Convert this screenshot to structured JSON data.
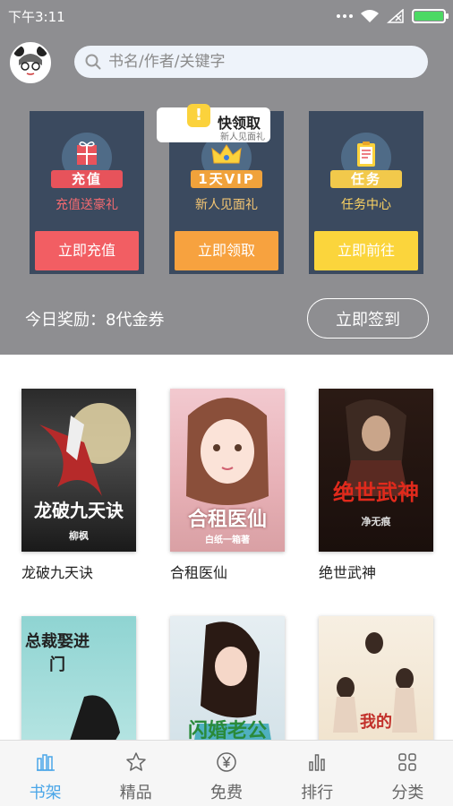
{
  "status_bar": {
    "time": "下午3:11",
    "battery_color": "#4cd964"
  },
  "header": {
    "avatar_icon": "panda-avatar-icon",
    "search": {
      "placeholder": "书名/作者/关键字",
      "icon": "search-icon"
    }
  },
  "promos": [
    {
      "ribbon": "充值",
      "subtitle": "充值送豪礼",
      "action": "立即充值",
      "icon": "gift-icon",
      "color": "#f25e63"
    },
    {
      "ribbon": "1天VIP",
      "subtitle": "新人见面礼",
      "action": "立即领取",
      "icon": "crown-icon",
      "color": "#f7a23f"
    },
    {
      "ribbon": "任务",
      "subtitle": "任务中心",
      "action": "立即前往",
      "icon": "clipboard-icon",
      "color": "#fbd53c"
    }
  ],
  "quick_tag": {
    "mark": "!",
    "title": "快领取",
    "subtitle": "新人见面礼"
  },
  "reward": {
    "text": "今日奖励：8代金券",
    "signin_label": "立即签到"
  },
  "books": [
    {
      "title": "龙破九天诀",
      "cover_title": "龙破九天诀",
      "cover_author": "柳枫"
    },
    {
      "title": "合租医仙",
      "cover_title": "合租医仙",
      "cover_author": "白纸一箱著"
    },
    {
      "title": "绝世武神",
      "cover_title": "绝世武神",
      "cover_author": "净无痕"
    },
    {
      "title": "",
      "cover_title": "总裁娶进门",
      "cover_author": ""
    },
    {
      "title": "",
      "cover_title": "闪婚老公",
      "cover_author": ""
    },
    {
      "title": "",
      "cover_title": "我的",
      "cover_author": ""
    }
  ],
  "nav": [
    {
      "label": "书架",
      "icon": "bookshelf-icon",
      "active": true
    },
    {
      "label": "精品",
      "icon": "star-icon",
      "active": false
    },
    {
      "label": "免费",
      "icon": "yen-icon",
      "active": false
    },
    {
      "label": "排行",
      "icon": "bar-chart-icon",
      "active": false
    },
    {
      "label": "分类",
      "icon": "grid-icon",
      "active": false
    }
  ],
  "accent_color": "#4aa6e8"
}
